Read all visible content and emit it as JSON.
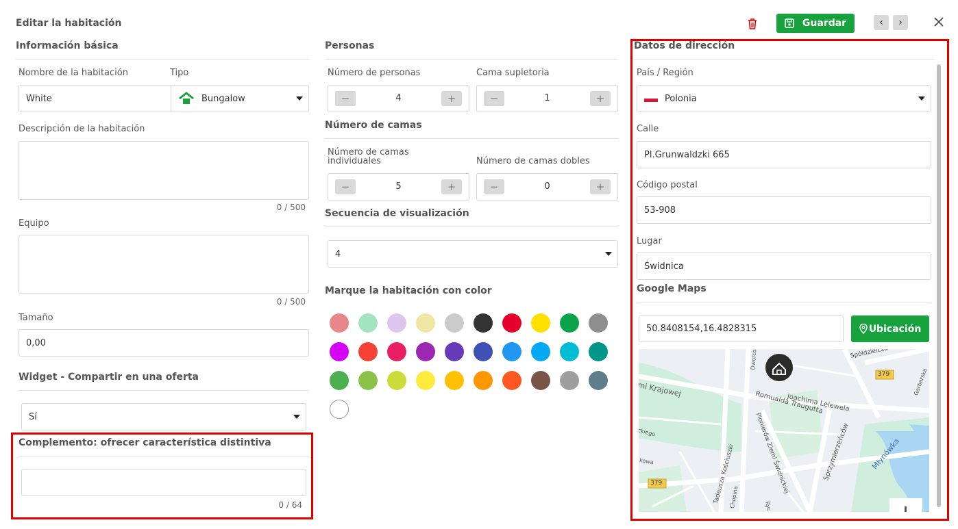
{
  "header": {
    "title": "Editar la habitación",
    "save_label": "Guardar",
    "prev_icon": "chevron-left-icon",
    "next_icon": "chevron-right-icon",
    "close_icon": "close-icon",
    "delete_icon": "trash-icon",
    "accent": "#18a23d"
  },
  "basic": {
    "heading": "Información básica",
    "name_label": "Nombre de la habitación",
    "name_value": "White",
    "type_label": "Tipo",
    "type_value": "Bungalow",
    "desc_label": "Descripción de la habitación",
    "desc_counter": "0 / 500",
    "equip_label": "Equipo",
    "equip_counter": "0 / 500",
    "size_label": "Tamaño",
    "size_value": "0,00"
  },
  "widget": {
    "heading": "Widget - Compartir en una oferta",
    "value": "Sí"
  },
  "complement": {
    "heading": "Complemento: ofrecer característica distintiva",
    "value": "",
    "counter": "0 / 64"
  },
  "persons": {
    "heading": "Personas",
    "num_label": "Número de personas",
    "num_value": "4",
    "extra_label": "Cama supletoria",
    "extra_value": "1"
  },
  "beds": {
    "heading": "Número de camas",
    "single_label": "Número de camas individuales",
    "single_value": "5",
    "double_label": "Número de camas dobles",
    "double_value": "0"
  },
  "sequence": {
    "heading": "Secuencia de visualización",
    "value": "4"
  },
  "colors": {
    "heading": "Marque la habitación con color",
    "swatches": [
      "#e88787",
      "#a3e4c1",
      "#dcc6ef",
      "#efe6a3",
      "#cccccc",
      "#333333",
      "#e8002d",
      "#ffe000",
      "#0ba34a",
      "#8e8e8e",
      "#d500f9",
      "#f44336",
      "#e91e63",
      "#9c27b0",
      "#673ab7",
      "#3f51b5",
      "#2196f3",
      "#03a9f4",
      "#00bcd4",
      "#009688",
      "#4caf50",
      "#8bc34a",
      "#cddc39",
      "#ffeb3b",
      "#ffc107",
      "#ff9800",
      "#ff5722",
      "#795548",
      "#9e9e9e",
      "#607d8b",
      "#ffffff"
    ]
  },
  "address": {
    "heading": "Datos de dirección",
    "country_label": "País / Región",
    "country_value": "Polonia",
    "street_label": "Calle",
    "street_value": "Pl.Grunwaldzki 665",
    "zip_label": "Código postal",
    "zip_value": "53-908",
    "place_label": "Lugar",
    "place_value": "Świdnica"
  },
  "maps": {
    "heading": "Google Maps",
    "coords": "50.8408154,16.4828315",
    "location_btn": "Ubicación",
    "streets": [
      "mi Krajowej",
      "Romualda Traugutta",
      "Joachima Lelewela",
      "Pionierów Ziemi Świdnickiej",
      "Sprzymierzeńców",
      "Młynówka",
      "Tadeusza Kościuszki",
      "Spółdzielcza",
      "Dworcowa",
      "Garbarska",
      "ckiego",
      "kowa",
      "Chopina",
      "Ryc"
    ],
    "road_badges": [
      "379",
      "379"
    ]
  }
}
